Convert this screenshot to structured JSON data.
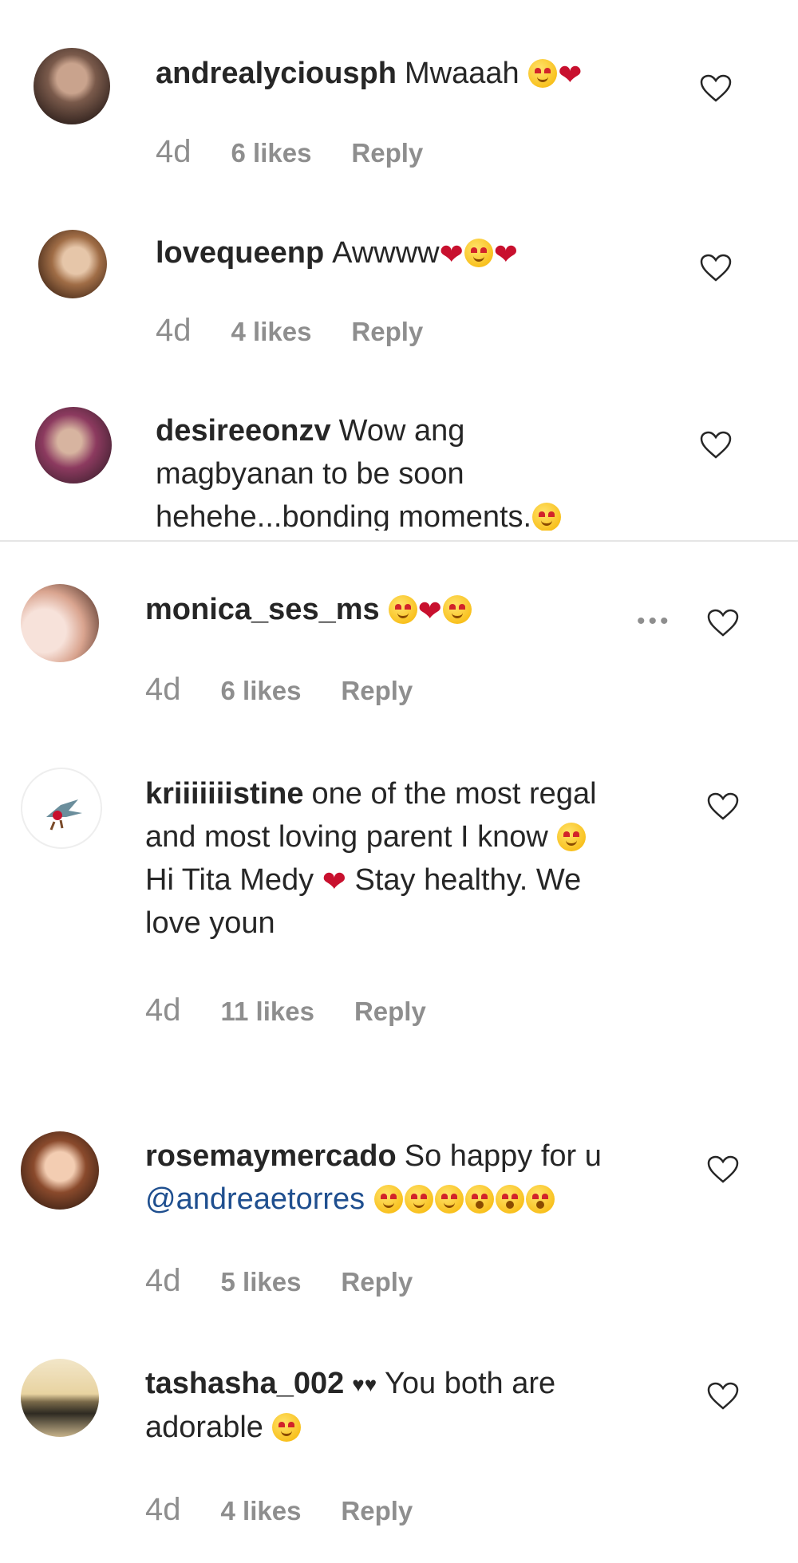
{
  "comments": [
    {
      "username": "andrealyciousph",
      "text": "Mwaaah",
      "emoji": [
        "heart-eyes-emoji",
        "two-hearts-emoji"
      ],
      "time": "4d",
      "likes": "6 likes",
      "reply": "Reply"
    },
    {
      "username": "lovequeenp",
      "text": "Awwww",
      "emoji": [
        "red-heart-emoji",
        "heart-eyes-emoji",
        "red-heart-emoji"
      ],
      "time": "4d",
      "likes": "4 likes",
      "reply": "Reply"
    },
    {
      "username": "desireeonzv",
      "line1": "Wow ang",
      "line2": "magbyanan to be soon",
      "line3": "hehehe...bonding moments.",
      "emoji": [
        "heart-eyes-emoji"
      ]
    },
    {
      "username": "monica_ses_ms",
      "emoji": [
        "heart-eyes-emoji",
        "red-heart-emoji",
        "heart-eyes-emoji"
      ],
      "more": "•••",
      "time": "4d",
      "likes": "6 likes",
      "reply": "Reply"
    },
    {
      "username": "kriiiiiiistine",
      "line1": "one of the most regal",
      "line2": "and most loving parent I know",
      "line3a": "Hi Tita Medy",
      "line3b": "Stay healthy. We",
      "line4": "love youn",
      "emoji": [
        "heart-eyes-emoji",
        "two-hearts-emoji"
      ],
      "time": "4d",
      "likes": "11 likes",
      "reply": "Reply"
    },
    {
      "username": "rosemaymercado",
      "line1": "So happy for u",
      "mention": "@andreaetorres",
      "emoji": [
        "heart-eyes-emoji",
        "heart-eyes-emoji",
        "heart-eyes-emoji",
        "heart-eyes-emoji",
        "heart-eyes-emoji",
        "heart-eyes-emoji"
      ],
      "time": "4d",
      "likes": "5 likes",
      "reply": "Reply"
    },
    {
      "username": "tashasha_002",
      "line1": "You both are",
      "line2": "adorable",
      "emoji": [
        "black-heart-emoji",
        "black-heart-emoji",
        "heart-eyes-emoji"
      ],
      "time": "4d",
      "likes": "4 likes",
      "reply": "Reply"
    }
  ],
  "colors": {
    "text": "#262626",
    "meta": "#8e8e8e",
    "mention": "#1f4f8f",
    "heart_emoji": "#c8102e"
  }
}
